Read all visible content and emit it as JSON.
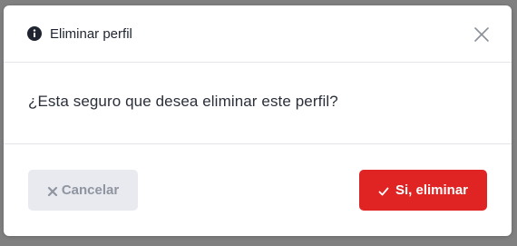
{
  "dialog": {
    "title": "Eliminar perfil",
    "title_icon": "info-circle-icon",
    "close_icon": "close-icon",
    "message": "¿Esta seguro que desea eliminar este perfil?"
  },
  "buttons": {
    "cancel": {
      "label": "Cancelar",
      "icon": "x-icon",
      "background": "#e8eaf0",
      "color": "#8f95a0"
    },
    "confirm": {
      "label": "Si, eliminar",
      "icon": "check-icon",
      "background": "#e02424",
      "color": "#ffffff"
    }
  },
  "colors": {
    "overlay": "#808080",
    "modal_background": "#ffffff",
    "divider": "#e4e6ea",
    "text": "#1f2430"
  }
}
